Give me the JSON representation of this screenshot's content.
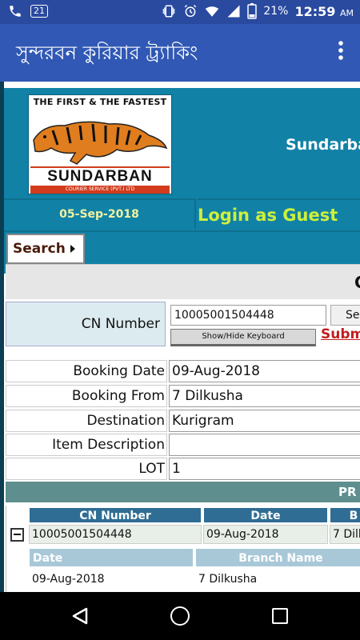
{
  "status_bar": {
    "sim_badge": "21",
    "battery_percent": "21%",
    "time": "12:59",
    "ampm": "AM"
  },
  "app_bar": {
    "title": "সুন্দরবন কুরিয়ার ট্র্যাকিং",
    "menu_icon": "more-vert-icon"
  },
  "header": {
    "logo_tagline": "THE FIRST & THE FASTEST",
    "logo_name": "SUNDARBAN",
    "logo_subtitle": "COURIER SERVICE (PVT.) LTD",
    "site_title": "Sundarba",
    "date": "05-Sep-2018",
    "login_text": "Login as Guest"
  },
  "menu": {
    "search_label": "Search"
  },
  "form": {
    "title_partial": "C",
    "cn_label": "CN Number",
    "cn_value": "10005001504448",
    "search_button_partial": "Sea",
    "keyboard_button": "Show/Hide Keyboard",
    "submit_partial": "Submi",
    "fields": [
      {
        "label": "Booking Date",
        "value": "09-Aug-2018"
      },
      {
        "label": "Booking From",
        "value": "7 Dilkusha"
      },
      {
        "label": "Destination",
        "value": "Kurigram"
      },
      {
        "label": "Item Description",
        "value": ""
      },
      {
        "label": "LOT",
        "value": "1"
      }
    ]
  },
  "results": {
    "bar_partial": "PR",
    "columns": [
      "CN Number",
      "Date",
      "B"
    ],
    "row": {
      "cn": "10005001504448",
      "date": "09-Aug-2018",
      "branch_partial": "7 Dilk"
    },
    "sub_columns": [
      "Date",
      "Branch Name"
    ],
    "sub_row": {
      "date": "09-Aug-2018",
      "branch": "7 Dilkusha"
    }
  },
  "colors": {
    "status_bar": "#2a4aa0",
    "app_bar": "#3058b4",
    "header_teal": "#1182a6",
    "login_green": "#cdf03c",
    "submit_red": "#c01e1e"
  }
}
